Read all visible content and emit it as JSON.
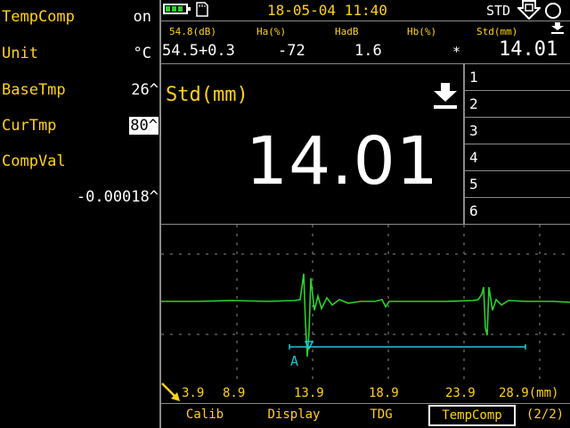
{
  "settings": {
    "items": [
      {
        "label": "TempComp",
        "value": "on"
      },
      {
        "label": "Unit",
        "value": "°C"
      },
      {
        "label": "BaseTmp",
        "value": "26^"
      },
      {
        "label": "CurTmp",
        "value": "80^"
      },
      {
        "label": "CompVal",
        "value": ""
      }
    ],
    "comp_value": "-0.00018^"
  },
  "status": {
    "datetime": "18-05-04 11:40",
    "mode": "STD",
    "battery_icon": "battery-icon",
    "sd_icon": "sd-card-icon",
    "arrow_icon": "freeze-arrow-icon",
    "circle_icon": "status-circle-icon"
  },
  "measure_header": {
    "labels": [
      "54.8(dB)",
      "Ha(%)",
      "HadB",
      "Hb(%)",
      "Std(mm)"
    ],
    "values": [
      "54.5+0.3",
      "-72",
      "1.6",
      "*",
      "14.01"
    ]
  },
  "main": {
    "title": "Std(mm)",
    "reading": "14.01",
    "hold_icon": "download-arrow-icon"
  },
  "memory_slots": [
    "1",
    "2",
    "3",
    "4",
    "5",
    "6"
  ],
  "waveform": {
    "gate_label": "A",
    "x_axis_ticks": [
      "3.9",
      "8.9",
      "13.9",
      "18.9",
      "23.9",
      "28.9(mm)"
    ],
    "colors": {
      "signal": "#2fd02f",
      "gate": "#21c8d8",
      "grid": "#8a8a8a",
      "text": "#ffd21e"
    }
  },
  "menu": {
    "items": [
      "Calib",
      "Display",
      "TDG",
      "TempComp"
    ],
    "active": "TempComp",
    "page": "(2/2)"
  }
}
